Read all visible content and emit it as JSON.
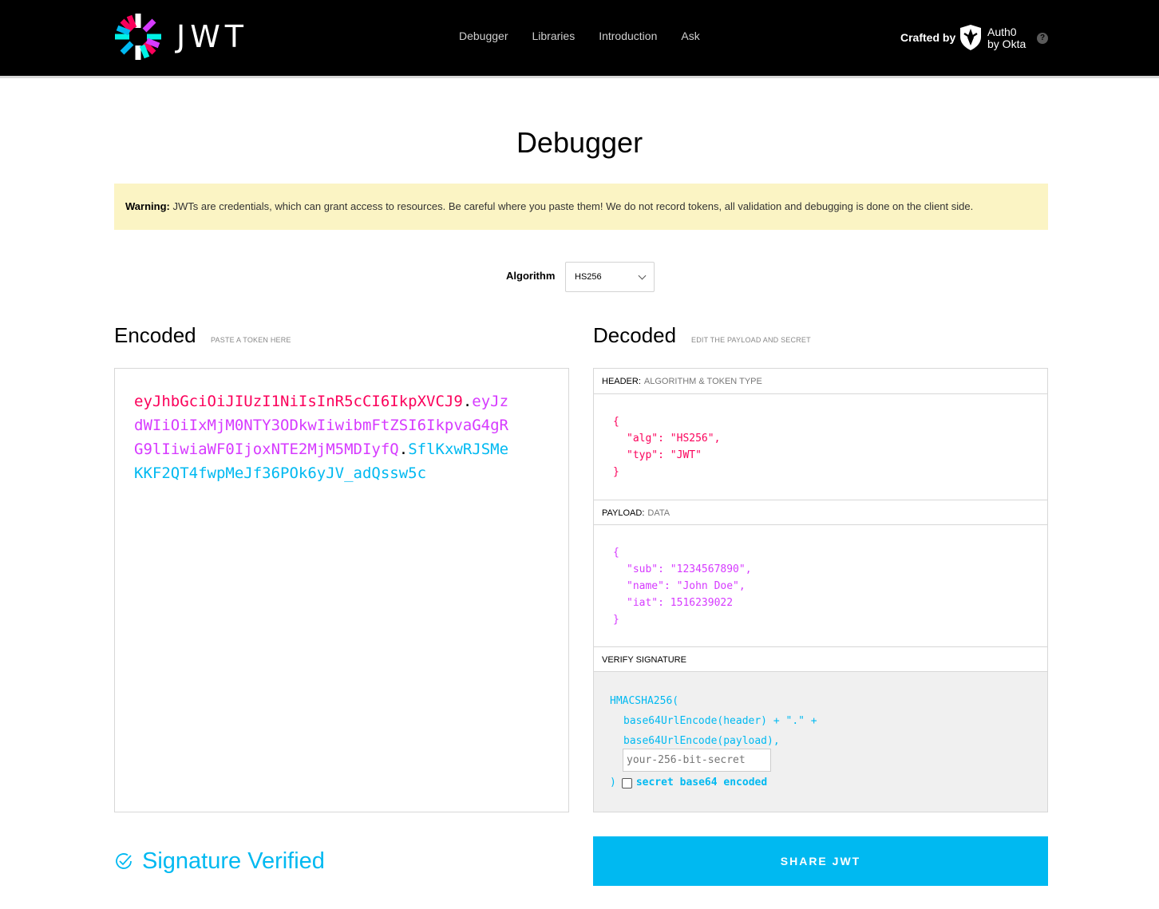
{
  "brand": {
    "wordmark": "JWT",
    "logo_icon": "jwt-starburst-icon"
  },
  "nav": {
    "items": [
      "Debugger",
      "Libraries",
      "Introduction",
      "Ask"
    ]
  },
  "crafted": {
    "label": "Crafted by",
    "auth0_line1": "Auth0",
    "auth0_line2": "by Okta",
    "help": "?"
  },
  "page": {
    "title": "Debugger"
  },
  "warning": {
    "bold": "Warning:",
    "text": " JWTs are credentials, which can grant access to resources. Be careful where you paste them! We do not record tokens, all validation and debugging is done on the client side."
  },
  "algorithm": {
    "label": "Algorithm",
    "selected": "HS256"
  },
  "encoded": {
    "title": "Encoded",
    "subtitle": "PASTE A TOKEN HERE",
    "header_part": "eyJhbGciOiJIUzI1NiIsInR5cCI6IkpXVCJ9",
    "payload_part": "eyJzdWIiOiIxMjM0NTY3ODkwIiwibmFtZSI6IkpvaG4gRG9lIiwiaWF0IjoxNTE2MjM5MDIyfQ",
    "signature_part": "SflKxwRJSMeKKF2QT4fwpMeJf36POk6yJV_adQssw5c",
    "dot": "."
  },
  "decoded": {
    "title": "Decoded",
    "subtitle": "EDIT THE PAYLOAD AND SECRET",
    "header_panel": {
      "label": "HEADER:",
      "sublabel": "ALGORITHM & TOKEN TYPE"
    },
    "header_json": {
      "open": "{",
      "lines": [
        "\"alg\": \"HS256\",",
        "\"typ\": \"JWT\""
      ],
      "close": "}"
    },
    "payload_panel": {
      "label": "PAYLOAD:",
      "sublabel": "DATA"
    },
    "payload_json": {
      "open": "{",
      "lines": [
        "\"sub\": \"1234567890\",",
        "\"name\": \"John Doe\",",
        "\"iat\": 1516239022"
      ],
      "close": "}"
    },
    "verify_panel": {
      "label": "VERIFY SIGNATURE"
    },
    "verify": {
      "fn": "HMACSHA256(",
      "line1": "base64UrlEncode(header) + \".\" +",
      "line2": "base64UrlEncode(payload),",
      "secret_placeholder": "your-256-bit-secret",
      "close": ")",
      "checkbox_label": "secret base64 encoded"
    }
  },
  "status": {
    "text": "Signature Verified"
  },
  "share": {
    "label": "SHARE JWT"
  },
  "colors": {
    "header": "#fb015b",
    "payload": "#d63aff",
    "signature": "#00b9f1",
    "warning_bg": "#fbf4c4"
  }
}
